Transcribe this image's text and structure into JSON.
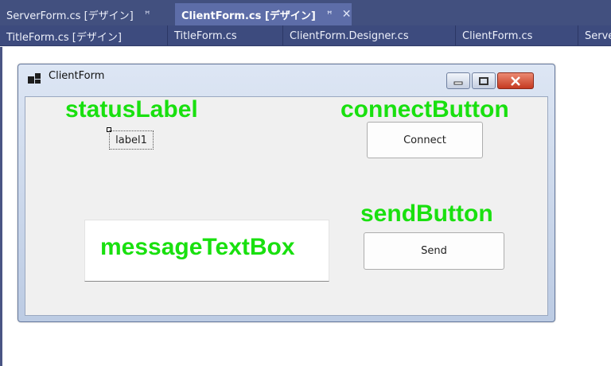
{
  "tabs_row1": [
    {
      "label": "ServerForm.cs [デザイン]",
      "pin": "ꟸ",
      "active": false
    },
    {
      "label": "ClientForm.cs [デザイン]",
      "pin": "ꟸ",
      "close": "✕",
      "active": true
    }
  ],
  "tabs_row2": [
    {
      "label": "TitleForm.cs [デザイン]"
    },
    {
      "label": "TitleForm.cs"
    },
    {
      "label": "ClientForm.Designer.cs"
    },
    {
      "label": "ClientForm.cs"
    },
    {
      "label": "Serve"
    }
  ],
  "form": {
    "title": "ClientForm",
    "label1_text": "label1",
    "connect_label": "Connect",
    "send_label": "Send"
  },
  "annotations": {
    "status_label": "statusLabel",
    "connect_button": "connectButton",
    "send_button": "sendButton",
    "message_textbox": "messageTextBox"
  },
  "colors": {
    "annotation": "#19e00f",
    "tab_bar": "#42507f",
    "active_tab": "#5d6da8"
  }
}
